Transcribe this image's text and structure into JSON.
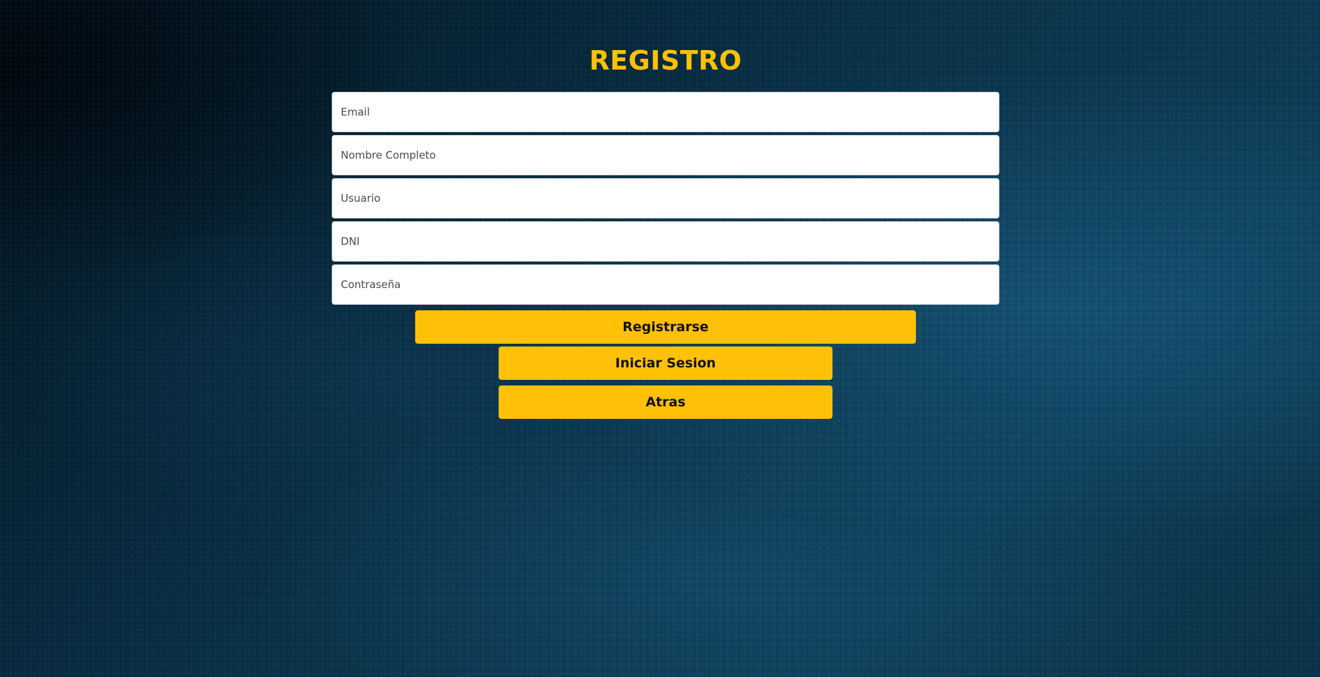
{
  "page": {
    "title": "REGISTRO",
    "accent_color": "#ffc107",
    "background_color": "#0a3148"
  },
  "form": {
    "fields": [
      {
        "name": "email",
        "placeholder": "Email",
        "value": ""
      },
      {
        "name": "full_name",
        "placeholder": "Nombre Completo",
        "value": ""
      },
      {
        "name": "username",
        "placeholder": "Usuario",
        "value": ""
      },
      {
        "name": "dni",
        "placeholder": "DNI",
        "value": ""
      },
      {
        "name": "password",
        "placeholder": "Contraseña",
        "value": ""
      }
    ]
  },
  "buttons": {
    "register_label": "Registrarse",
    "login_label": "Iniciar Sesion",
    "back_label": "Atras"
  }
}
